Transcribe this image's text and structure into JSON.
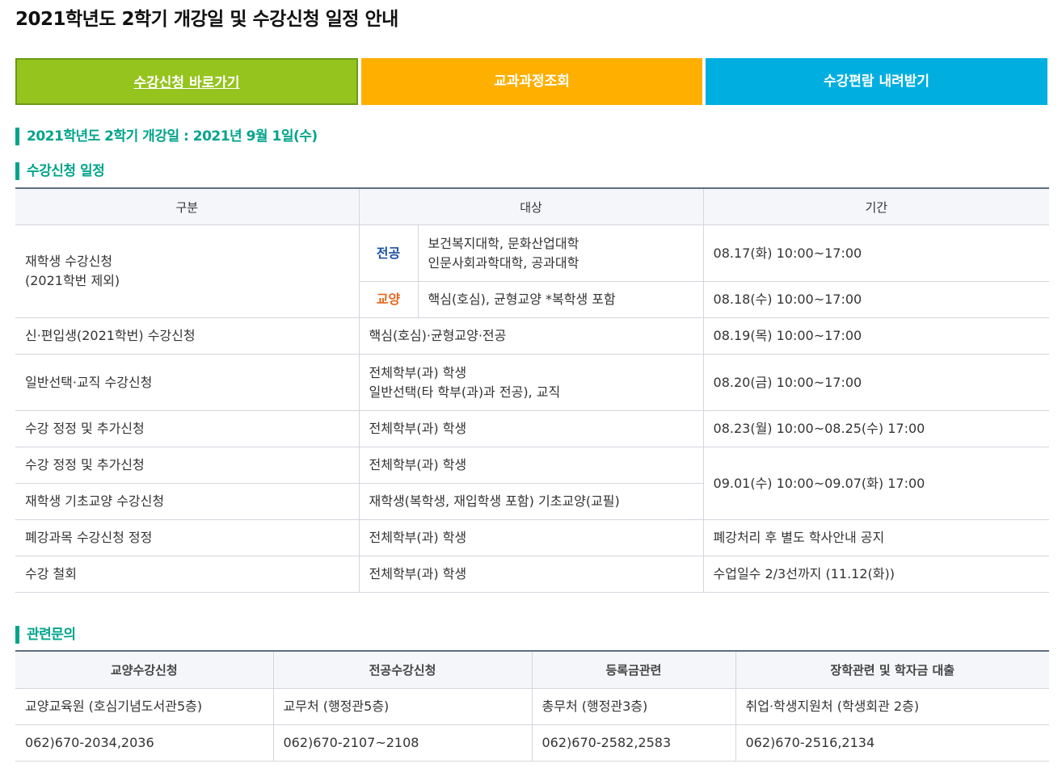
{
  "page_title": "2021학년도 2학기 개강일 및 수강신청 일정 안내",
  "buttons": {
    "register": "수강신청 바로가기",
    "curriculum": "교과과정조회",
    "handbook": "수강편람 내려받기"
  },
  "sections": {
    "opening_day": "2021학년도 2학기 개강일 : 2021년 9월 1일(수)",
    "schedule": "수강신청 일정",
    "contact": "관련문의"
  },
  "schedule_table": {
    "headers": [
      "구분",
      "대상",
      "기간"
    ],
    "returning": {
      "category_line1": "재학생 수강신청",
      "category_line2": "(2021학번 제외)",
      "major_tag": "전공",
      "major_target_line1": "보건복지대학, 문화산업대학",
      "major_target_line2": "인문사회과학대학, 공과대학",
      "major_period": "08.17(화) 10:00~17:00",
      "liberal_tag": "교양",
      "liberal_target": "핵심(호심), 균형교양 *복학생 포함",
      "liberal_period": "08.18(수) 10:00~17:00"
    },
    "rows": [
      {
        "category": "신·편입생(2021학번) 수강신청",
        "target": "핵심(호심)·균형교양·전공",
        "period": "08.19(목) 10:00~17:00"
      },
      {
        "category": "일반선택·교직 수강신청",
        "target_line1": "전체학부(과) 학생",
        "target_line2": "일반선택(타 학부(과)과 전공), 교직",
        "period": "08.20(금) 10:00~17:00"
      },
      {
        "category": "수강 정정 및 추가신청",
        "target": "전체학부(과) 학생",
        "period": "08.23(월) 10:00~08.25(수) 17:00"
      },
      {
        "category": "수강 정정 및 추가신청",
        "target": "전체학부(과) 학생",
        "period": "09.01(수) 10:00~09.07(화) 17:00"
      },
      {
        "category": "재학생 기초교양 수강신청",
        "target": "재학생(복학생, 재입학생 포함) 기초교양(교필)"
      },
      {
        "category": "폐강과목 수강신청 정정",
        "target": "전체학부(과) 학생",
        "period": "폐강처리 후 별도 학사안내 공지"
      },
      {
        "category": "수강 철회",
        "target": "전체학부(과) 학생",
        "period": "수업일수 2/3선까지 (11.12(화))"
      }
    ]
  },
  "contact_table": {
    "headers": [
      "교양수강신청",
      "전공수강신청",
      "등록금관련",
      "장학관련 및 학자금 대출"
    ],
    "offices": [
      "교양교육원 (호심기념도서관5층)",
      "교무처 (행정관5층)",
      "총무처 (행정관3층)",
      "취업·학생지원처 (학생회관 2층)"
    ],
    "phones": [
      "062)670-2034,2036",
      "062)670-2107~2108",
      "062)670-2582,2583",
      "062)670-2516,2134"
    ]
  },
  "colors": {
    "btn_green": "#95c41f",
    "btn_orange": "#ffaf00",
    "btn_blue": "#00afe0",
    "section_teal": "#00a48b",
    "tag_major": "#1b4fa6",
    "tag_liberal": "#e8651d"
  }
}
